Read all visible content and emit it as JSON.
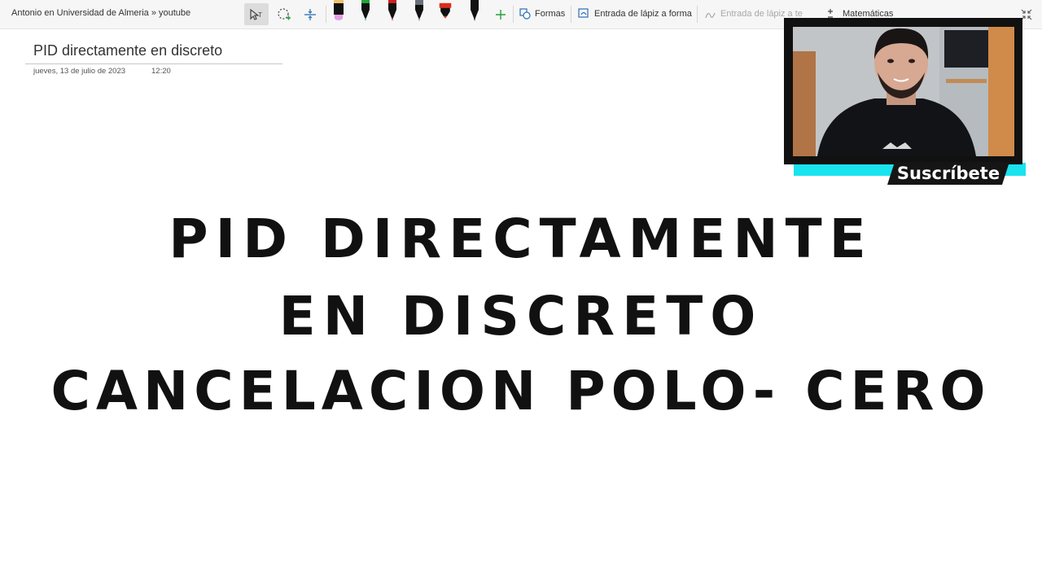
{
  "toolbar": {
    "breadcrumb": "Antonio en Universidad de Almeria » youtube",
    "shapes_label": "Formas",
    "ink_to_shape_label": "Entrada de lápiz a forma",
    "ink_to_text_label": "Entrada de lápiz a te",
    "math_label": "Matemáticas",
    "pen_colors": [
      "#e79ce8",
      "#22a33a",
      "#d02020",
      "#555a66",
      "#e22a1a",
      "#111111"
    ]
  },
  "page": {
    "title": "PID directamente en discreto",
    "date": "jueves, 13 de julio de 2023",
    "time": "12:20"
  },
  "headline": {
    "line1": "PID DIRECTAMENTE",
    "line2": "EN DISCRETO",
    "line3": "CANCELACION POLO- CERO"
  },
  "webcam": {
    "subscribe_label": "Suscríbete",
    "accent_color": "#19e3ef"
  }
}
